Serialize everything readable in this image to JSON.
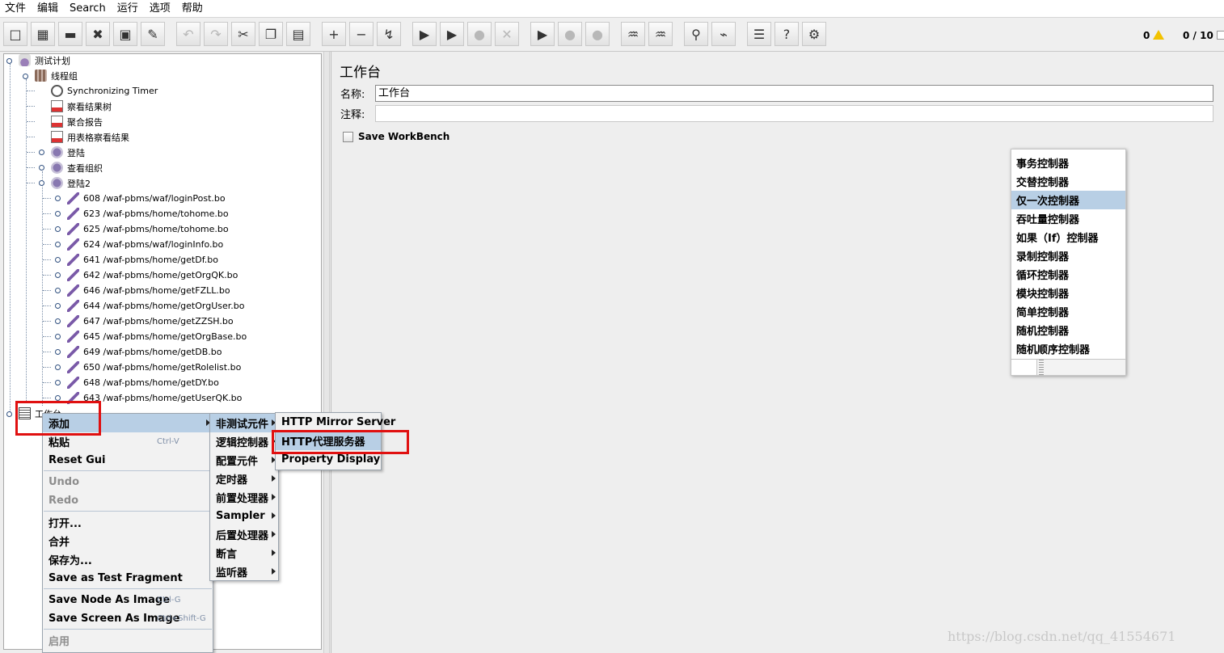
{
  "menubar": [
    "文件",
    "编辑",
    "Search",
    "运行",
    "选项",
    "帮助"
  ],
  "toolbar": {
    "buttons": [
      {
        "name": "new-icon",
        "glyph": "□"
      },
      {
        "name": "templates-icon",
        "glyph": "▦"
      },
      {
        "name": "open-icon",
        "glyph": "▬"
      },
      {
        "name": "close-icon",
        "glyph": "✖"
      },
      {
        "name": "save-icon",
        "glyph": "▣"
      },
      {
        "name": "save-as-icon",
        "glyph": "✎"
      },
      {
        "name": "undo-icon",
        "glyph": "↶"
      },
      {
        "name": "redo-icon",
        "glyph": "↷"
      },
      {
        "name": "cut-icon",
        "glyph": "✂"
      },
      {
        "name": "copy-icon",
        "glyph": "❐"
      },
      {
        "name": "paste-icon",
        "glyph": "▤"
      },
      {
        "name": "expand-icon",
        "glyph": "+"
      },
      {
        "name": "collapse-icon",
        "glyph": "−"
      },
      {
        "name": "toggle-icon",
        "glyph": "↯"
      },
      {
        "name": "start-icon",
        "glyph": "▶"
      },
      {
        "name": "start-no-timers-icon",
        "glyph": "▶"
      },
      {
        "name": "stop-icon",
        "glyph": "●"
      },
      {
        "name": "shutdown-icon",
        "glyph": "✕"
      },
      {
        "name": "remote-start-icon",
        "glyph": "▶"
      },
      {
        "name": "remote-stop-icon",
        "glyph": "●"
      },
      {
        "name": "remote-exit-icon",
        "glyph": "●"
      },
      {
        "name": "clear-icon",
        "glyph": "♒"
      },
      {
        "name": "clear-all-icon",
        "glyph": "♒"
      },
      {
        "name": "search-icon",
        "glyph": "⚲"
      },
      {
        "name": "reset-search-icon",
        "glyph": "⌁"
      },
      {
        "name": "function-helper-icon",
        "glyph": "☰"
      },
      {
        "name": "help-icon",
        "glyph": "?"
      },
      {
        "name": "log-icon",
        "glyph": "⚙"
      }
    ],
    "warnings": "0",
    "threads": "0 / 10"
  },
  "tree": {
    "test_plan": "测试计划",
    "thread_group": "线程组",
    "nodes": [
      {
        "label": "Synchronizing Timer",
        "icon": "timer-icon"
      },
      {
        "label": "察看结果树",
        "icon": "report-icon"
      },
      {
        "label": "聚合报告",
        "icon": "report-icon"
      },
      {
        "label": "用表格察看结果",
        "icon": "report-icon"
      },
      {
        "label": "登陆",
        "icon": "controller-icon"
      },
      {
        "label": "查看组织",
        "icon": "controller-icon"
      },
      {
        "label": "登陆2",
        "icon": "controller-icon"
      }
    ],
    "samplers": [
      "608 /waf-pbms/waf/loginPost.bo",
      "623 /waf-pbms/home/tohome.bo",
      "625 /waf-pbms/home/tohome.bo",
      "624 /waf-pbms/waf/loginInfo.bo",
      "641 /waf-pbms/home/getDf.bo",
      "642 /waf-pbms/home/getOrgQK.bo",
      "646 /waf-pbms/home/getFZLL.bo",
      "644 /waf-pbms/home/getOrgUser.bo",
      "647 /waf-pbms/home/getZZSH.bo",
      "645 /waf-pbms/home/getOrgBase.bo",
      "649 /waf-pbms/home/getDB.bo",
      "650 /waf-pbms/home/getRolelist.bo",
      "648 /waf-pbms/home/getDY.bo",
      "643 /waf-pbms/home/getUserQK.bo"
    ],
    "workbench": "工作台"
  },
  "workbench_panel": {
    "title": "工作台",
    "name_label": "名称:",
    "name_value": "工作台",
    "comment_label": "注释:",
    "comment_value": "",
    "save_workbench": "Save WorkBench"
  },
  "context_menu": {
    "items": [
      {
        "label": "添加",
        "submenu": true,
        "highlight": true
      },
      {
        "label": "粘贴",
        "accel": "Ctrl-V"
      },
      {
        "label": "Reset Gui"
      },
      {
        "sep": true
      },
      {
        "label": "Undo",
        "disabled": true
      },
      {
        "label": "Redo",
        "disabled": true
      },
      {
        "sep": true
      },
      {
        "label": "打开..."
      },
      {
        "label": "合并"
      },
      {
        "label": "保存为..."
      },
      {
        "label": "Save as Test Fragment"
      },
      {
        "sep": true
      },
      {
        "label": "Save Node As Image",
        "accel": "Ctrl-G"
      },
      {
        "label": "Save Screen As Image",
        "accel": "Ctrl+Shift-G"
      },
      {
        "sep": true
      },
      {
        "label": "启用",
        "disabled": true
      }
    ]
  },
  "add_submenu": {
    "items": [
      {
        "label": "非测试元件",
        "highlight": true
      },
      {
        "label": "逻辑控制器"
      },
      {
        "label": "配置元件"
      },
      {
        "label": "定时器"
      },
      {
        "label": "前置处理器"
      },
      {
        "label": "Sampler"
      },
      {
        "label": "后置处理器"
      },
      {
        "label": "断言"
      },
      {
        "label": "监听器"
      }
    ]
  },
  "non_test_submenu": {
    "items": [
      {
        "label": "HTTP Mirror Server"
      },
      {
        "label": "HTTP代理服务器",
        "highlight": true
      },
      {
        "label": "Property Display"
      }
    ]
  },
  "logic_popup": {
    "items": [
      "事务控制器",
      "交替控制器",
      "仅一次控制器",
      "吞吐量控制器",
      "如果（If）控制器",
      "录制控制器",
      "循环控制器",
      "模块控制器",
      "简单控制器",
      "随机控制器",
      "随机顺序控制器"
    ],
    "highlight_index": 2
  },
  "watermark": "https://blog.csdn.net/qq_41554671"
}
